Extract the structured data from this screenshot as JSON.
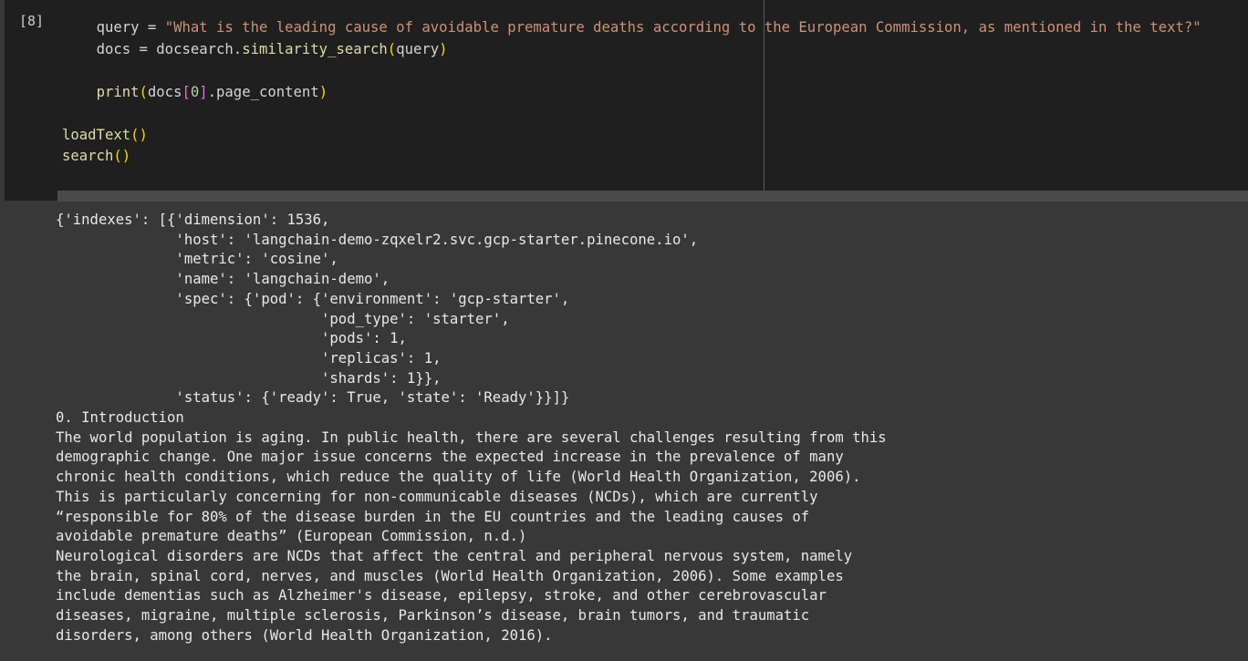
{
  "cell": {
    "execution_count": "[8]",
    "code_lines": {
      "l1_indent": "    ",
      "l1_var": "query",
      "l1_eq": " = ",
      "l1_str": "\"What is the leading cause of avoidable premature deaths according to the European Commission, as mentioned in the text?\"",
      "l2_indent": "    ",
      "l2_var": "docs",
      "l2_eq": " = ",
      "l2_obj": "docsearch.",
      "l2_fn": "similarity_search",
      "l2_open": "(",
      "l2_arg": "query",
      "l2_close": ")",
      "l4_indent": "    ",
      "l4_fn": "print",
      "l4_open": "(",
      "l4_obj": "docs",
      "l4_bopen": "[",
      "l4_num": "0",
      "l4_bclose": "]",
      "l4_attr": ".page_content",
      "l4_close": ")",
      "l6_fn": "loadText",
      "l6_parens": "()",
      "l7_fn": "search",
      "l7_parens": "()"
    }
  },
  "output": {
    "text": "{'indexes': [{'dimension': 1536,\n              'host': 'langchain-demo-zqxelr2.svc.gcp-starter.pinecone.io',\n              'metric': 'cosine',\n              'name': 'langchain-demo',\n              'spec': {'pod': {'environment': 'gcp-starter',\n                               'pod_type': 'starter',\n                               'pods': 1,\n                               'replicas': 1,\n                               'shards': 1}},\n              'status': {'ready': True, 'state': 'Ready'}}]}\n0. Introduction\nThe world population is aging. In public health, there are several challenges resulting from this\ndemographic change. One major issue concerns the expected increase in the prevalence of many\nchronic health conditions, which reduce the quality of life (World Health Organization, 2006).\nThis is particularly concerning for non-communicable diseases (NCDs), which are currently\n“responsible for 80% of the disease burden in the EU countries and the leading causes of\navoidable premature deaths” (European Commission, n.d.)\nNeurological disorders are NCDs that affect the central and peripheral nervous system, namely\nthe brain, spinal cord, nerves, and muscles (World Health Organization, 2006). Some examples\ninclude dementias such as Alzheimer's disease, epilepsy, stroke, and other cerebrovascular\ndiseases, migraine, multiple sclerosis, Parkinson’s disease, brain tumors, and traumatic\ndisorders, among others (World Health Organization, 2016)."
  },
  "colors": {
    "cell_background": "#1f1f1f",
    "output_background": "#383838",
    "string": "#ce9178",
    "function": "#dcdcaa",
    "bracket_paren": "#ffd700",
    "bracket_square": "#da70d6"
  }
}
